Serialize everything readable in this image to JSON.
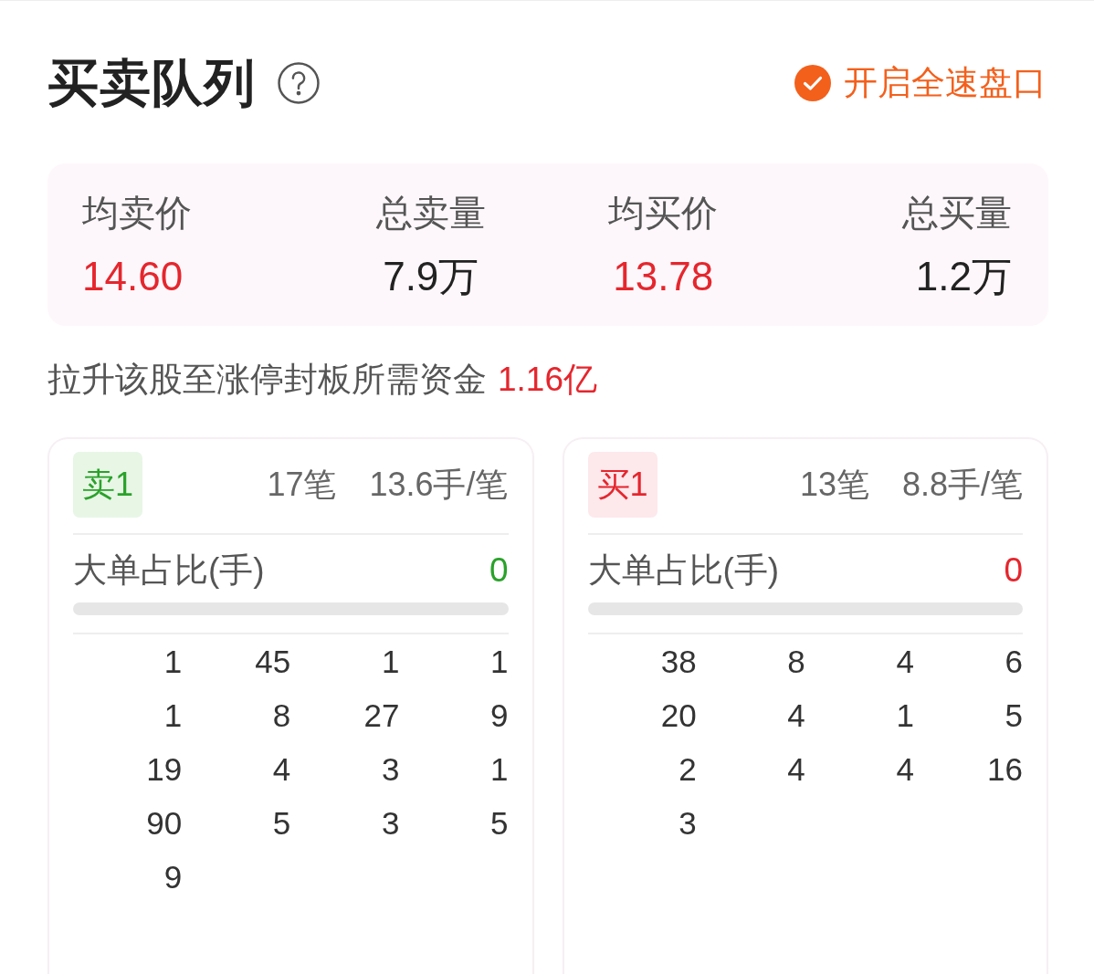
{
  "header": {
    "title": "买卖队列",
    "fast_mode": {
      "label": "开启全速盘口",
      "checked": true
    }
  },
  "stats": [
    {
      "label": "均卖价",
      "value": "14.60",
      "color": "#e5262d"
    },
    {
      "label": "总卖量",
      "value": "7.9万",
      "color": "#222222"
    },
    {
      "label": "均买价",
      "value": "13.78",
      "color": "#e5262d"
    },
    {
      "label": "总买量",
      "value": "1.2万",
      "color": "#222222"
    }
  ],
  "funds": {
    "label": "拉升该股至涨停封板所需资金",
    "value": "1.16亿"
  },
  "queues": [
    {
      "kind": "sell",
      "side": "卖1",
      "count": "17笔",
      "average": "13.6手/笔",
      "big_order_label": "大单占比(手)",
      "big_order_value": "0",
      "level": 0,
      "orders": [
        "1",
        "45",
        "1",
        "1",
        "1",
        "8",
        "27",
        "9",
        "19",
        "4",
        "3",
        "1",
        "90",
        "5",
        "3",
        "5",
        "9"
      ]
    },
    {
      "kind": "buy",
      "side": "买1",
      "count": "13笔",
      "average": "8.8手/笔",
      "big_order_label": "大单占比(手)",
      "big_order_value": "0",
      "level": 0,
      "orders": [
        "38",
        "8",
        "4",
        "6",
        "20",
        "4",
        "1",
        "5",
        "2",
        "4",
        "4",
        "16",
        "3"
      ]
    }
  ]
}
